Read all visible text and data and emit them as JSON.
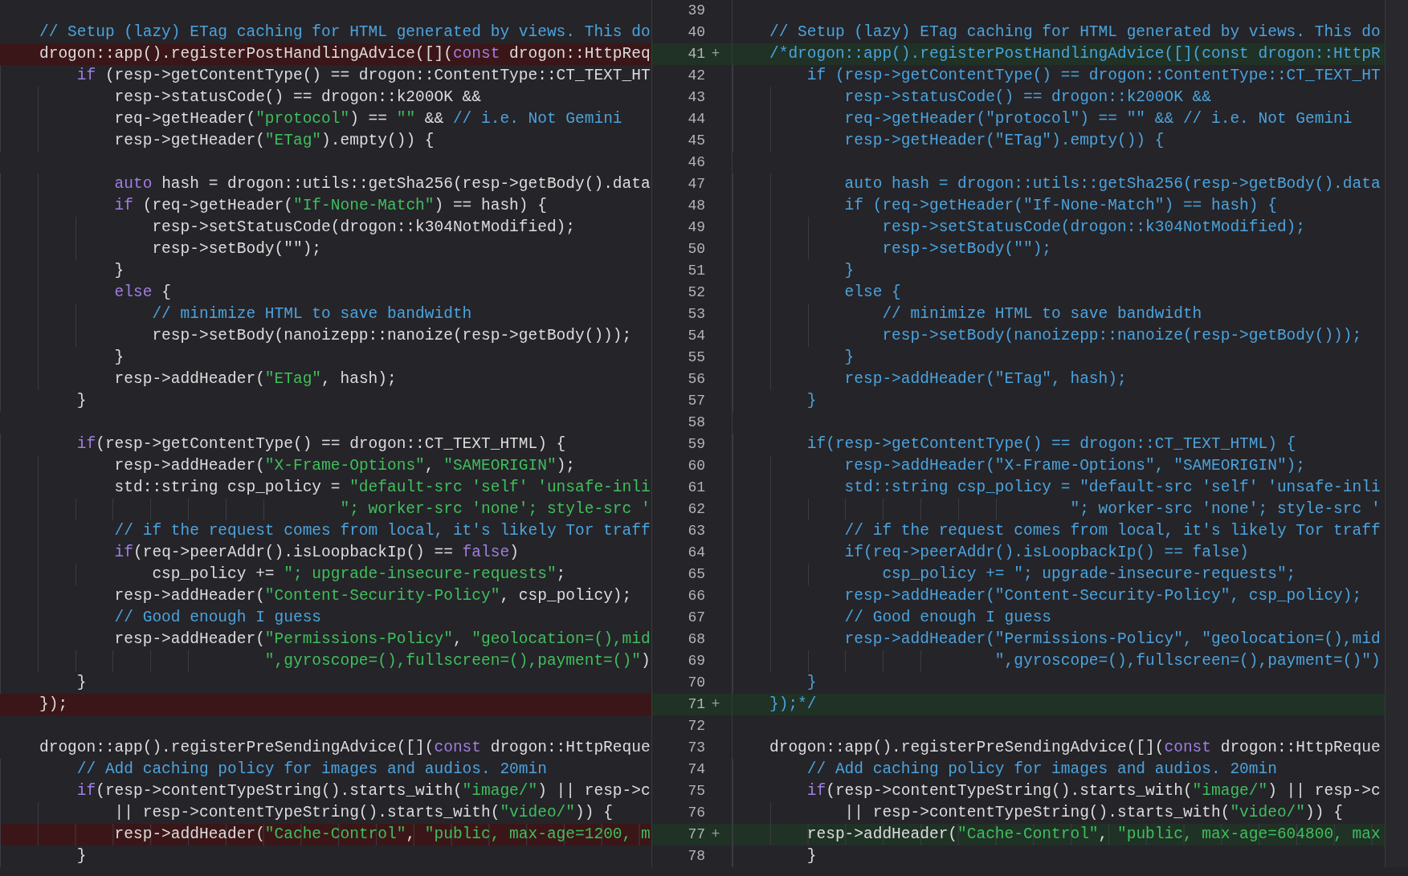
{
  "rows": [
    {
      "number": "39",
      "left": {
        "removed": false
      },
      "right": {
        "added": false
      }
    },
    {
      "number": "40",
      "left": {
        "removed": false,
        "segments": [
          {
            "text": "// Setup (lazy) ETag caching for HTML generated by views. This do",
            "kind": "comment"
          }
        ]
      },
      "right": {
        "added": false,
        "segments": [
          {
            "text": "// Setup (lazy) ETag caching for HTML generated by views. This do",
            "kind": "comment"
          }
        ]
      }
    },
    {
      "number": "41",
      "left": {
        "removed": true,
        "segments": [
          {
            "text": "drogon::app().registerPostHandlingAdvice([](",
            "kind": "plain"
          },
          {
            "text": "const",
            "kind": "keyword"
          },
          {
            "text": " drogon::HttpReq",
            "kind": "plain"
          }
        ]
      },
      "right": {
        "added": true,
        "marker": "+",
        "segments": [
          {
            "text": "/*drogon::app().registerPostHandlingAdvice([](const drogon::HttpR",
            "kind": "comment"
          }
        ]
      }
    },
    {
      "number": "42",
      "left": {
        "removed": false,
        "segments": [
          {
            "text": "    if",
            "kind": "keyword"
          },
          {
            "text": " (resp->getContentType() == drogon::ContentType::CT_TEXT_HT",
            "kind": "plain"
          }
        ]
      },
      "right": {
        "added": false,
        "segments": [
          {
            "text": "    if (resp->getContentType() == drogon::ContentType::CT_TEXT_HT",
            "kind": "comment"
          }
        ]
      }
    },
    {
      "number": "43",
      "left": {
        "removed": false,
        "segments": [
          {
            "text": "        resp->statusCode() == drogon::k200OK &&",
            "kind": "plain"
          }
        ]
      },
      "right": {
        "added": false,
        "segments": [
          {
            "text": "        resp->statusCode() == drogon::k200OK &&",
            "kind": "comment"
          }
        ]
      }
    },
    {
      "number": "44",
      "left": {
        "removed": false,
        "segments": [
          {
            "text": "        req->getHeader(",
            "kind": "plain"
          },
          {
            "text": "\"protocol\"",
            "kind": "string"
          },
          {
            "text": ") == ",
            "kind": "plain"
          },
          {
            "text": "\"\"",
            "kind": "string"
          },
          {
            "text": " && ",
            "kind": "plain"
          },
          {
            "text": "// i.e. Not Gemini",
            "kind": "comment"
          }
        ]
      },
      "right": {
        "added": false,
        "segments": [
          {
            "text": "        req->getHeader(\"protocol\") == \"\" && // i.e. Not Gemini",
            "kind": "comment"
          }
        ]
      }
    },
    {
      "number": "45",
      "left": {
        "removed": false,
        "segments": [
          {
            "text": "        resp->getHeader(",
            "kind": "plain"
          },
          {
            "text": "\"ETag\"",
            "kind": "string"
          },
          {
            "text": ").empty()) {",
            "kind": "plain"
          }
        ]
      },
      "right": {
        "added": false,
        "segments": [
          {
            "text": "        resp->getHeader(\"ETag\").empty()) {",
            "kind": "comment"
          }
        ]
      }
    },
    {
      "number": "46",
      "left": {
        "removed": false
      },
      "right": {
        "added": false
      }
    },
    {
      "number": "47",
      "left": {
        "removed": false,
        "segments": [
          {
            "text": "        auto",
            "kind": "keyword"
          },
          {
            "text": " hash = drogon::utils::getSha256(resp->getBody().data",
            "kind": "plain"
          }
        ]
      },
      "right": {
        "added": false,
        "segments": [
          {
            "text": "        auto hash = drogon::utils::getSha256(resp->getBody().data",
            "kind": "comment"
          }
        ]
      }
    },
    {
      "number": "48",
      "left": {
        "removed": false,
        "segments": [
          {
            "text": "        if",
            "kind": "keyword"
          },
          {
            "text": " (req->getHeader(",
            "kind": "plain"
          },
          {
            "text": "\"If-None-Match\"",
            "kind": "string"
          },
          {
            "text": ") == hash) {",
            "kind": "plain"
          }
        ]
      },
      "right": {
        "added": false,
        "segments": [
          {
            "text": "        if (req->getHeader(\"If-None-Match\") == hash) {",
            "kind": "comment"
          }
        ]
      }
    },
    {
      "number": "49",
      "left": {
        "removed": false,
        "segments": [
          {
            "text": "            resp->setStatusCode(drogon::k304NotModified);",
            "kind": "plain"
          }
        ]
      },
      "right": {
        "added": false,
        "segments": [
          {
            "text": "            resp->setStatusCode(drogon::k304NotModified);",
            "kind": "comment"
          }
        ]
      }
    },
    {
      "number": "50",
      "left": {
        "removed": false,
        "segments": [
          {
            "text": "            resp->setBody(\"\");",
            "kind": "plain"
          }
        ]
      },
      "right": {
        "added": false,
        "segments": [
          {
            "text": "            resp->setBody(\"\");",
            "kind": "comment"
          }
        ]
      }
    },
    {
      "number": "51",
      "left": {
        "removed": false,
        "segments": [
          {
            "text": "        }",
            "kind": "plain"
          }
        ]
      },
      "right": {
        "added": false,
        "segments": [
          {
            "text": "        }",
            "kind": "comment"
          }
        ]
      }
    },
    {
      "number": "52",
      "left": {
        "removed": false,
        "segments": [
          {
            "text": "        else",
            "kind": "keyword"
          },
          {
            "text": " {",
            "kind": "plain"
          }
        ]
      },
      "right": {
        "added": false,
        "segments": [
          {
            "text": "        else {",
            "kind": "comment"
          }
        ]
      }
    },
    {
      "number": "53",
      "left": {
        "removed": false,
        "segments": [
          {
            "text": "            // minimize HTML to save bandwidth",
            "kind": "comment"
          }
        ]
      },
      "right": {
        "added": false,
        "segments": [
          {
            "text": "            // minimize HTML to save bandwidth",
            "kind": "comment"
          }
        ]
      }
    },
    {
      "number": "54",
      "left": {
        "removed": false,
        "segments": [
          {
            "text": "            resp->setBody(nanoizepp::nanoize(resp->getBody()));",
            "kind": "plain"
          }
        ]
      },
      "right": {
        "added": false,
        "segments": [
          {
            "text": "            resp->setBody(nanoizepp::nanoize(resp->getBody()));",
            "kind": "comment"
          }
        ]
      }
    },
    {
      "number": "55",
      "left": {
        "removed": false,
        "segments": [
          {
            "text": "        }",
            "kind": "plain"
          }
        ]
      },
      "right": {
        "added": false,
        "segments": [
          {
            "text": "        }",
            "kind": "comment"
          }
        ]
      }
    },
    {
      "number": "56",
      "left": {
        "removed": false,
        "segments": [
          {
            "text": "        resp->addHeader(",
            "kind": "plain"
          },
          {
            "text": "\"ETag\"",
            "kind": "string"
          },
          {
            "text": ", hash);",
            "kind": "plain"
          }
        ]
      },
      "right": {
        "added": false,
        "segments": [
          {
            "text": "        resp->addHeader(\"ETag\", hash);",
            "kind": "comment"
          }
        ]
      }
    },
    {
      "number": "57",
      "left": {
        "removed": false,
        "segments": [
          {
            "text": "    }",
            "kind": "plain"
          }
        ]
      },
      "right": {
        "added": false,
        "segments": [
          {
            "text": "    }",
            "kind": "comment"
          }
        ]
      }
    },
    {
      "number": "58",
      "left": {
        "removed": false
      },
      "right": {
        "added": false
      }
    },
    {
      "number": "59",
      "left": {
        "removed": false,
        "segments": [
          {
            "text": "    if",
            "kind": "keyword"
          },
          {
            "text": "(resp->getContentType() == drogon::CT_TEXT_HTML) {",
            "kind": "plain"
          }
        ]
      },
      "right": {
        "added": false,
        "segments": [
          {
            "text": "    if(resp->getContentType() == drogon::CT_TEXT_HTML) {",
            "kind": "comment"
          }
        ]
      }
    },
    {
      "number": "60",
      "left": {
        "removed": false,
        "segments": [
          {
            "text": "        resp->addHeader(",
            "kind": "plain"
          },
          {
            "text": "\"X-Frame-Options\"",
            "kind": "string"
          },
          {
            "text": ", ",
            "kind": "plain"
          },
          {
            "text": "\"SAMEORIGIN\"",
            "kind": "string"
          },
          {
            "text": ");",
            "kind": "plain"
          }
        ]
      },
      "right": {
        "added": false,
        "segments": [
          {
            "text": "        resp->addHeader(\"X-Frame-Options\", \"SAMEORIGIN\");",
            "kind": "comment"
          }
        ]
      }
    },
    {
      "number": "61",
      "left": {
        "removed": false,
        "segments": [
          {
            "text": "        std::string csp_policy = ",
            "kind": "plain"
          },
          {
            "text": "\"default-src 'self' 'unsafe-inli",
            "kind": "string"
          }
        ]
      },
      "right": {
        "added": false,
        "segments": [
          {
            "text": "        std::string csp_policy = \"default-src 'self' 'unsafe-inli",
            "kind": "comment"
          }
        ]
      }
    },
    {
      "number": "62",
      "left": {
        "removed": false,
        "segments": [
          {
            "text": "                                \"; worker-src 'none'; style-src '",
            "kind": "string"
          }
        ]
      },
      "right": {
        "added": false,
        "segments": [
          {
            "text": "                                \"; worker-src 'none'; style-src '",
            "kind": "comment"
          }
        ]
      }
    },
    {
      "number": "63",
      "left": {
        "removed": false,
        "segments": [
          {
            "text": "        // if the request comes from local, it's likely Tor traff",
            "kind": "comment"
          }
        ]
      },
      "right": {
        "added": false,
        "segments": [
          {
            "text": "        // if the request comes from local, it's likely Tor traff",
            "kind": "comment"
          }
        ]
      }
    },
    {
      "number": "64",
      "left": {
        "removed": false,
        "segments": [
          {
            "text": "        if",
            "kind": "keyword"
          },
          {
            "text": "(req->peerAddr().isLoopbackIp() == ",
            "kind": "plain"
          },
          {
            "text": "false",
            "kind": "keyword"
          },
          {
            "text": ")",
            "kind": "plain"
          }
        ]
      },
      "right": {
        "added": false,
        "segments": [
          {
            "text": "        if(req->peerAddr().isLoopbackIp() == false)",
            "kind": "comment"
          }
        ]
      }
    },
    {
      "number": "65",
      "left": {
        "removed": false,
        "segments": [
          {
            "text": "            csp_policy += ",
            "kind": "plain"
          },
          {
            "text": "\"; upgrade-insecure-requests\"",
            "kind": "string"
          },
          {
            "text": ";",
            "kind": "plain"
          }
        ]
      },
      "right": {
        "added": false,
        "segments": [
          {
            "text": "            csp_policy += \"; upgrade-insecure-requests\";",
            "kind": "comment"
          }
        ]
      }
    },
    {
      "number": "66",
      "left": {
        "removed": false,
        "segments": [
          {
            "text": "        resp->addHeader(",
            "kind": "plain"
          },
          {
            "text": "\"Content-Security-Policy\"",
            "kind": "string"
          },
          {
            "text": ", csp_policy);",
            "kind": "plain"
          }
        ]
      },
      "right": {
        "added": false,
        "segments": [
          {
            "text": "        resp->addHeader(\"Content-Security-Policy\", csp_policy);",
            "kind": "comment"
          }
        ]
      }
    },
    {
      "number": "67",
      "left": {
        "removed": false,
        "segments": [
          {
            "text": "        // Good enough I guess",
            "kind": "comment"
          }
        ]
      },
      "right": {
        "added": false,
        "segments": [
          {
            "text": "        // Good enough I guess",
            "kind": "comment"
          }
        ]
      }
    },
    {
      "number": "68",
      "left": {
        "removed": false,
        "segments": [
          {
            "text": "        resp->addHeader(",
            "kind": "plain"
          },
          {
            "text": "\"Permissions-Policy\"",
            "kind": "string"
          },
          {
            "text": ", ",
            "kind": "plain"
          },
          {
            "text": "\"geolocation=(),mid",
            "kind": "string"
          }
        ]
      },
      "right": {
        "added": false,
        "segments": [
          {
            "text": "        resp->addHeader(\"Permissions-Policy\", \"geolocation=(),mid",
            "kind": "comment"
          }
        ]
      }
    },
    {
      "number": "69",
      "left": {
        "removed": false,
        "segments": [
          {
            "text": "                        \",gyroscope=(),fullscreen=(),payment=()\"",
            "kind": "string"
          },
          {
            "text": ")",
            "kind": "plain"
          }
        ]
      },
      "right": {
        "added": false,
        "segments": [
          {
            "text": "                        \",gyroscope=(),fullscreen=(),payment=()\")",
            "kind": "comment"
          }
        ]
      }
    },
    {
      "number": "70",
      "left": {
        "removed": false,
        "segments": [
          {
            "text": "    }",
            "kind": "plain"
          }
        ]
      },
      "right": {
        "added": false,
        "segments": [
          {
            "text": "    }",
            "kind": "comment"
          }
        ]
      }
    },
    {
      "number": "71",
      "left": {
        "removed": true,
        "segments": [
          {
            "text": "});",
            "kind": "plain"
          }
        ]
      },
      "right": {
        "added": true,
        "marker": "+",
        "segments": [
          {
            "text": "});*/",
            "kind": "comment"
          }
        ]
      }
    },
    {
      "number": "72",
      "left": {
        "removed": false
      },
      "right": {
        "added": false
      }
    },
    {
      "number": "73",
      "left": {
        "removed": false,
        "segments": [
          {
            "text": "drogon::app().registerPreSendingAdvice([](",
            "kind": "plain"
          },
          {
            "text": "const",
            "kind": "keyword"
          },
          {
            "text": " drogon::HttpReque",
            "kind": "plain"
          }
        ]
      },
      "right": {
        "added": false,
        "segments": [
          {
            "text": "drogon::app().registerPreSendingAdvice([](",
            "kind": "plain"
          },
          {
            "text": "const",
            "kind": "keyword"
          },
          {
            "text": " drogon::HttpReque",
            "kind": "plain"
          }
        ]
      }
    },
    {
      "number": "74",
      "left": {
        "removed": false,
        "segments": [
          {
            "text": "    // Add caching policy for images and audios. 20min",
            "kind": "comment"
          }
        ]
      },
      "right": {
        "added": false,
        "segments": [
          {
            "text": "    // Add caching policy for images and audios. 20min",
            "kind": "comment"
          }
        ]
      }
    },
    {
      "number": "75",
      "left": {
        "removed": false,
        "segments": [
          {
            "text": "    if",
            "kind": "keyword"
          },
          {
            "text": "(resp->contentTypeString().starts_with(",
            "kind": "plain"
          },
          {
            "text": "\"image/\"",
            "kind": "string"
          },
          {
            "text": ") || resp->c",
            "kind": "plain"
          }
        ]
      },
      "right": {
        "added": false,
        "segments": [
          {
            "text": "    if",
            "kind": "keyword"
          },
          {
            "text": "(resp->contentTypeString().starts_with(",
            "kind": "plain"
          },
          {
            "text": "\"image/\"",
            "kind": "string"
          },
          {
            "text": ") || resp->c",
            "kind": "plain"
          }
        ]
      }
    },
    {
      "number": "76",
      "left": {
        "removed": false,
        "segments": [
          {
            "text": "        || resp->contentTypeString().starts_with(",
            "kind": "plain"
          },
          {
            "text": "\"video/\"",
            "kind": "string"
          },
          {
            "text": ")) {",
            "kind": "plain"
          }
        ]
      },
      "right": {
        "added": false,
        "segments": [
          {
            "text": "        || resp->contentTypeString().starts_with(",
            "kind": "plain"
          },
          {
            "text": "\"video/\"",
            "kind": "string"
          },
          {
            "text": ")) {",
            "kind": "plain"
          }
        ]
      }
    },
    {
      "number": "77",
      "left": {
        "removed": true,
        "segments": [
          {
            "text": "        resp->addHeader(",
            "kind": "plain"
          },
          {
            "text": "\"Cache-Control\"",
            "kind": "string"
          },
          {
            "text": ", ",
            "kind": "plain"
          },
          {
            "text": "\"public, max-age=1200, m",
            "kind": "string"
          }
        ]
      },
      "right": {
        "added": true,
        "marker": "+",
        "segments": [
          {
            "text": "    resp->addHeader(",
            "kind": "plain"
          },
          {
            "text": "\"Cache-Control\"",
            "kind": "string"
          },
          {
            "text": ", ",
            "kind": "plain"
          },
          {
            "text": "\"public, max-age=604800, max",
            "kind": "string"
          }
        ]
      }
    },
    {
      "number": "78",
      "left": {
        "removed": false,
        "segments": [
          {
            "text": "    }",
            "kind": "plain"
          }
        ]
      },
      "right": {
        "added": false,
        "segments": [
          {
            "text": "    }",
            "kind": "plain"
          }
        ]
      }
    }
  ]
}
